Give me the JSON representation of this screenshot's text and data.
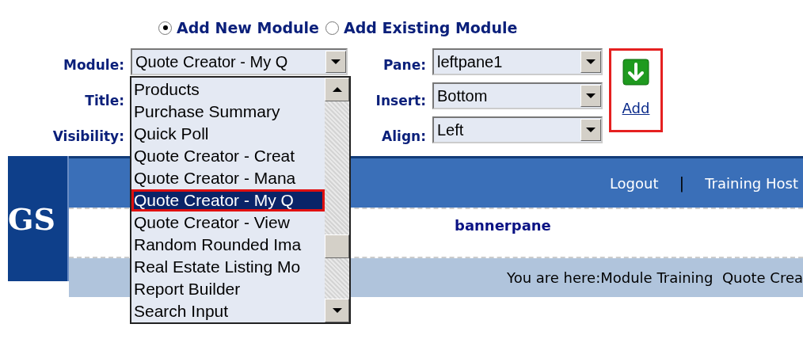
{
  "mode_options": [
    {
      "label": "Add New Module",
      "selected": true
    },
    {
      "label": "Add Existing Module",
      "selected": false
    }
  ],
  "form": {
    "module": {
      "label": "Module:",
      "value": "Quote Creator - My Q"
    },
    "title": {
      "label": "Title:"
    },
    "visibility": {
      "label": "Visibility:"
    },
    "pane": {
      "label": "Pane:",
      "value": "leftpane1"
    },
    "insert": {
      "label": "Insert:",
      "value": "Bottom"
    },
    "align": {
      "label": "Align:",
      "value": "Left"
    }
  },
  "add_link": "Add",
  "module_list": {
    "items": [
      {
        "label": "Products",
        "selected": false
      },
      {
        "label": "Purchase Summary",
        "selected": false
      },
      {
        "label": "Quick Poll",
        "selected": false
      },
      {
        "label": "Quote Creator - Creat",
        "selected": false
      },
      {
        "label": "Quote Creator - Mana",
        "selected": false
      },
      {
        "label": "Quote Creator - My Q",
        "selected": true
      },
      {
        "label": "Quote Creator - View",
        "selected": false
      },
      {
        "label": "Random Rounded Ima",
        "selected": false
      },
      {
        "label": "Real Estate Listing Mo",
        "selected": false
      },
      {
        "label": "Report Builder",
        "selected": false
      },
      {
        "label": "Search Input",
        "selected": false
      }
    ]
  },
  "banner": {
    "logo_text": "GS",
    "links": [
      "Logout",
      "Training Host"
    ],
    "separator": "|",
    "pane_label": "bannerpane",
    "breadcrumb": "You are here:Module Training  Quote Crea"
  }
}
